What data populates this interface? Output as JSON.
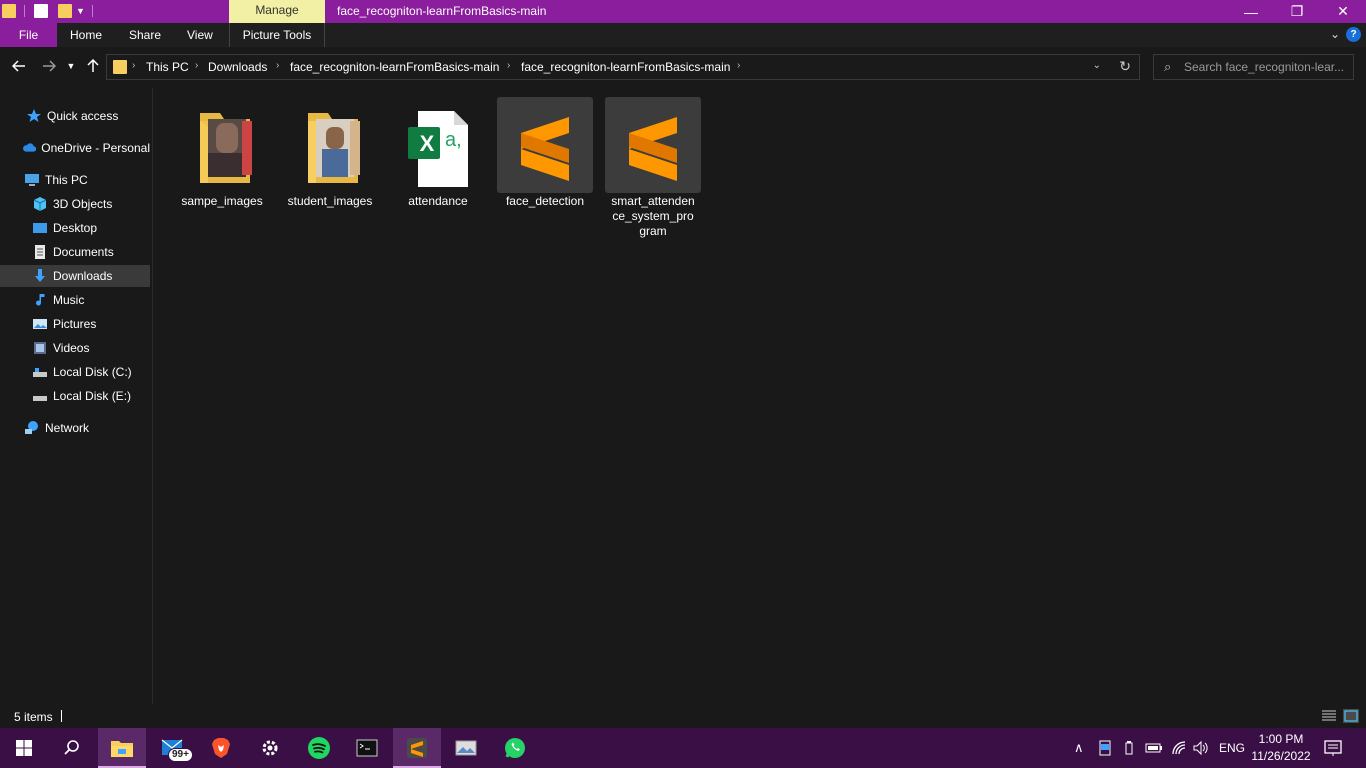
{
  "titlebar": {
    "manage_label": "Manage",
    "window_title": "face_recogniton-learnFromBasics-main",
    "minimize_icon": "—",
    "maximize_icon": "❐",
    "close_icon": "✕"
  },
  "ribbon": {
    "tabs": [
      "File",
      "Home",
      "Share",
      "View"
    ],
    "picture_tools_label": "Picture Tools",
    "help_label": "?",
    "accent_color": "#8a1e9c",
    "manage_color": "#f1f0a5"
  },
  "address": {
    "breadcrumbs": [
      "This PC",
      "Downloads",
      "face_recogniton-learnFromBasics-main",
      "face_recogniton-learnFromBasics-main"
    ],
    "search_placeholder": "Search face_recogniton-lear..."
  },
  "sidebar": {
    "items": [
      {
        "label": "Quick access",
        "icon": "star-icon"
      },
      {
        "label": "OneDrive - Personal",
        "icon": "cloud-icon"
      },
      {
        "label": "This PC",
        "icon": "computer-icon"
      },
      {
        "label": "3D Objects",
        "icon": "cube-icon"
      },
      {
        "label": "Desktop",
        "icon": "desktop-icon"
      },
      {
        "label": "Documents",
        "icon": "document-icon"
      },
      {
        "label": "Downloads",
        "icon": "download-icon",
        "selected": true
      },
      {
        "label": "Music",
        "icon": "music-icon"
      },
      {
        "label": "Pictures",
        "icon": "pictures-icon"
      },
      {
        "label": "Videos",
        "icon": "video-icon"
      },
      {
        "label": "Local Disk (C:)",
        "icon": "drive-icon"
      },
      {
        "label": "Local Disk (E:)",
        "icon": "drive-icon"
      },
      {
        "label": "Network",
        "icon": "network-icon"
      }
    ]
  },
  "files": [
    {
      "name": "sampe_images",
      "type": "folder-with-photo"
    },
    {
      "name": "student_images",
      "type": "folder-with-photo"
    },
    {
      "name": "attendance",
      "type": "excel-csv"
    },
    {
      "name": "face_detection",
      "type": "sublime-file"
    },
    {
      "name": "smart_attendence_system_program",
      "type": "sublime-file"
    }
  ],
  "excel_letters": {
    "badge": "X",
    "page": "a,"
  },
  "status": {
    "item_count": "5 items"
  },
  "taskbar": {
    "apps": [
      "start-icon",
      "search-icon",
      "file-explorer-icon",
      "mail-icon",
      "brave-icon",
      "settings-icon",
      "spotify-icon",
      "terminal-icon",
      "sublime-icon",
      "photos-icon",
      "whatsapp-icon"
    ],
    "mail_badge": "99+",
    "language": "ENG",
    "time": "1:00 PM",
    "date": "11/26/2022"
  }
}
